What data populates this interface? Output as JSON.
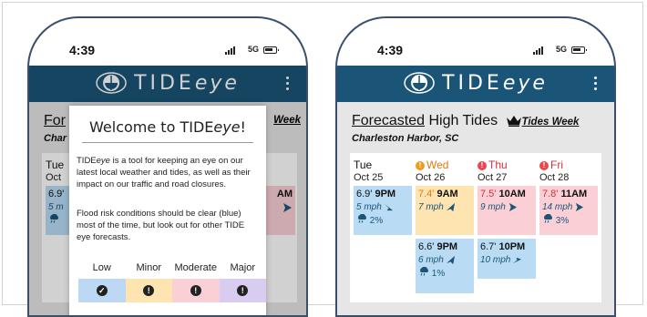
{
  "status": {
    "time": "4:39",
    "network": "5G"
  },
  "app": {
    "logo_prefix": "TIDE",
    "logo_suffix": "eye"
  },
  "page": {
    "heading_strong": "Forecasted",
    "heading_rest": " High Tides",
    "week_link": "Tides Week",
    "location": "Charleston Harbor, SC"
  },
  "left_peek": {
    "heading_fragment": "For",
    "week_fragment": "Week",
    "location_fragment": "Char",
    "day": "Tue",
    "date": "Oct",
    "tide_fragment": "6.9'",
    "wind_fragment": "5 m",
    "right_tide_fragment": "AM"
  },
  "forecast": {
    "days": [
      {
        "name": "Tue",
        "date": "Oct 25",
        "alert": false
      },
      {
        "name": "Wed",
        "date": "Oct 26",
        "alert": true,
        "alert_color": "#f39a1e"
      },
      {
        "name": "Thu",
        "date": "Oct 27",
        "alert": true,
        "alert_color": "#e8474f"
      },
      {
        "name": "Fri",
        "date": "Oct 28",
        "alert": true,
        "alert_color": "#e8474f"
      }
    ],
    "tiles": [
      {
        "height": "6.9'",
        "time": "9PM",
        "wind": "5 mph",
        "rain": "2%",
        "bg": "#b9dcf4",
        "wind_color": "#1a5577"
      },
      {
        "height": "7.4'",
        "time": "9AM",
        "wind": "7 mph",
        "rain": "",
        "bg": "#fde4b0",
        "wind_color": "#1a5577",
        "height_color": "#e07a10"
      },
      {
        "height": "7.5'",
        "time": "10AM",
        "wind": "9 mph",
        "rain": "",
        "bg": "#fad0d6",
        "wind_color": "#1a5577",
        "height_color": "#d32f3c"
      },
      {
        "height": "7.8'",
        "time": "11AM",
        "wind": "14 mph",
        "rain": "3%",
        "bg": "#fad0d6",
        "wind_color": "#1a5577",
        "height_color": "#d32f3c"
      },
      {
        "height": "6.6'",
        "time": "9PM",
        "wind": "6 mph",
        "rain": "1%",
        "bg": "#b9dcf4",
        "wind_color": "#1a5577"
      },
      {
        "height": "6.7'",
        "time": "10PM",
        "wind": "10 mph",
        "rain": "",
        "bg": "#b9dcf4",
        "wind_color": "#1a5577"
      }
    ]
  },
  "modal": {
    "title_prefix": "Welcome to TIDE",
    "title_italic": "eye",
    "title_suffix": "!",
    "para1_prefix": "TIDE",
    "para1_italic": "eye",
    "para1_rest": " is a tool for keeping an eye on our latest local weather and tides, as well as their impact on our traffic and road closures.",
    "para2": "Flood risk conditions should be clear (blue) most of the time, but look out for other TIDE eye forecasts.",
    "legend": [
      {
        "label": "Low",
        "color": "#bcd8f2",
        "icon": "check"
      },
      {
        "label": "Minor",
        "color": "#fde4b0",
        "icon": "!"
      },
      {
        "label": "Moderate",
        "color": "#fad0d6",
        "icon": "!"
      },
      {
        "label": "Major",
        "color": "#d8cdf0",
        "icon": "!"
      }
    ]
  },
  "colors": {
    "appbar": "#1a5577",
    "phone_border": "#3a4e6e"
  }
}
